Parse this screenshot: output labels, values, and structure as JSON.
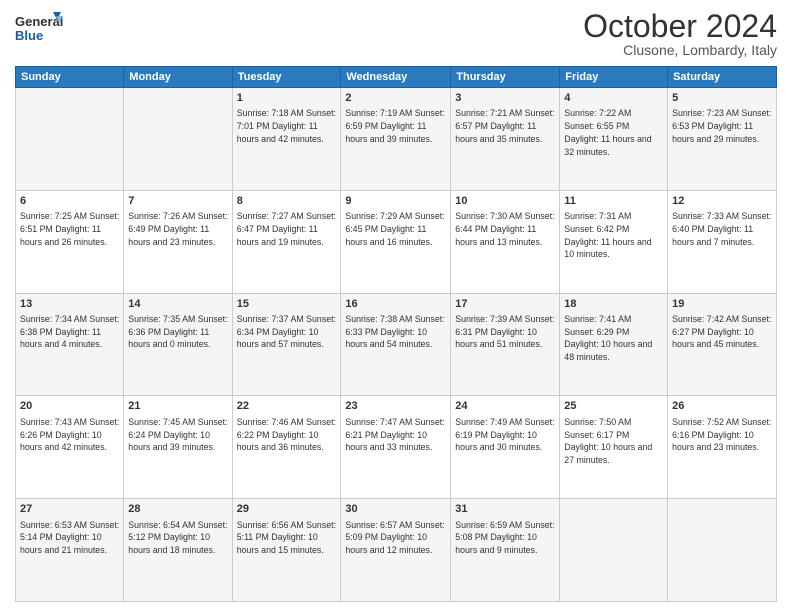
{
  "logo": {
    "line1": "General",
    "line2": "Blue"
  },
  "title": "October 2024",
  "subtitle": "Clusone, Lombardy, Italy",
  "days_of_week": [
    "Sunday",
    "Monday",
    "Tuesday",
    "Wednesday",
    "Thursday",
    "Friday",
    "Saturday"
  ],
  "weeks": [
    [
      {
        "day": "",
        "info": ""
      },
      {
        "day": "",
        "info": ""
      },
      {
        "day": "1",
        "info": "Sunrise: 7:18 AM\nSunset: 7:01 PM\nDaylight: 11 hours and 42 minutes."
      },
      {
        "day": "2",
        "info": "Sunrise: 7:19 AM\nSunset: 6:59 PM\nDaylight: 11 hours and 39 minutes."
      },
      {
        "day": "3",
        "info": "Sunrise: 7:21 AM\nSunset: 6:57 PM\nDaylight: 11 hours and 35 minutes."
      },
      {
        "day": "4",
        "info": "Sunrise: 7:22 AM\nSunset: 6:55 PM\nDaylight: 11 hours and 32 minutes."
      },
      {
        "day": "5",
        "info": "Sunrise: 7:23 AM\nSunset: 6:53 PM\nDaylight: 11 hours and 29 minutes."
      }
    ],
    [
      {
        "day": "6",
        "info": "Sunrise: 7:25 AM\nSunset: 6:51 PM\nDaylight: 11 hours and 26 minutes."
      },
      {
        "day": "7",
        "info": "Sunrise: 7:26 AM\nSunset: 6:49 PM\nDaylight: 11 hours and 23 minutes."
      },
      {
        "day": "8",
        "info": "Sunrise: 7:27 AM\nSunset: 6:47 PM\nDaylight: 11 hours and 19 minutes."
      },
      {
        "day": "9",
        "info": "Sunrise: 7:29 AM\nSunset: 6:45 PM\nDaylight: 11 hours and 16 minutes."
      },
      {
        "day": "10",
        "info": "Sunrise: 7:30 AM\nSunset: 6:44 PM\nDaylight: 11 hours and 13 minutes."
      },
      {
        "day": "11",
        "info": "Sunrise: 7:31 AM\nSunset: 6:42 PM\nDaylight: 11 hours and 10 minutes."
      },
      {
        "day": "12",
        "info": "Sunrise: 7:33 AM\nSunset: 6:40 PM\nDaylight: 11 hours and 7 minutes."
      }
    ],
    [
      {
        "day": "13",
        "info": "Sunrise: 7:34 AM\nSunset: 6:38 PM\nDaylight: 11 hours and 4 minutes."
      },
      {
        "day": "14",
        "info": "Sunrise: 7:35 AM\nSunset: 6:36 PM\nDaylight: 11 hours and 0 minutes."
      },
      {
        "day": "15",
        "info": "Sunrise: 7:37 AM\nSunset: 6:34 PM\nDaylight: 10 hours and 57 minutes."
      },
      {
        "day": "16",
        "info": "Sunrise: 7:38 AM\nSunset: 6:33 PM\nDaylight: 10 hours and 54 minutes."
      },
      {
        "day": "17",
        "info": "Sunrise: 7:39 AM\nSunset: 6:31 PM\nDaylight: 10 hours and 51 minutes."
      },
      {
        "day": "18",
        "info": "Sunrise: 7:41 AM\nSunset: 6:29 PM\nDaylight: 10 hours and 48 minutes."
      },
      {
        "day": "19",
        "info": "Sunrise: 7:42 AM\nSunset: 6:27 PM\nDaylight: 10 hours and 45 minutes."
      }
    ],
    [
      {
        "day": "20",
        "info": "Sunrise: 7:43 AM\nSunset: 6:26 PM\nDaylight: 10 hours and 42 minutes."
      },
      {
        "day": "21",
        "info": "Sunrise: 7:45 AM\nSunset: 6:24 PM\nDaylight: 10 hours and 39 minutes."
      },
      {
        "day": "22",
        "info": "Sunrise: 7:46 AM\nSunset: 6:22 PM\nDaylight: 10 hours and 36 minutes."
      },
      {
        "day": "23",
        "info": "Sunrise: 7:47 AM\nSunset: 6:21 PM\nDaylight: 10 hours and 33 minutes."
      },
      {
        "day": "24",
        "info": "Sunrise: 7:49 AM\nSunset: 6:19 PM\nDaylight: 10 hours and 30 minutes."
      },
      {
        "day": "25",
        "info": "Sunrise: 7:50 AM\nSunset: 6:17 PM\nDaylight: 10 hours and 27 minutes."
      },
      {
        "day": "26",
        "info": "Sunrise: 7:52 AM\nSunset: 6:16 PM\nDaylight: 10 hours and 23 minutes."
      }
    ],
    [
      {
        "day": "27",
        "info": "Sunrise: 6:53 AM\nSunset: 5:14 PM\nDaylight: 10 hours and 21 minutes."
      },
      {
        "day": "28",
        "info": "Sunrise: 6:54 AM\nSunset: 5:12 PM\nDaylight: 10 hours and 18 minutes."
      },
      {
        "day": "29",
        "info": "Sunrise: 6:56 AM\nSunset: 5:11 PM\nDaylight: 10 hours and 15 minutes."
      },
      {
        "day": "30",
        "info": "Sunrise: 6:57 AM\nSunset: 5:09 PM\nDaylight: 10 hours and 12 minutes."
      },
      {
        "day": "31",
        "info": "Sunrise: 6:59 AM\nSunset: 5:08 PM\nDaylight: 10 hours and 9 minutes."
      },
      {
        "day": "",
        "info": ""
      },
      {
        "day": "",
        "info": ""
      }
    ]
  ]
}
